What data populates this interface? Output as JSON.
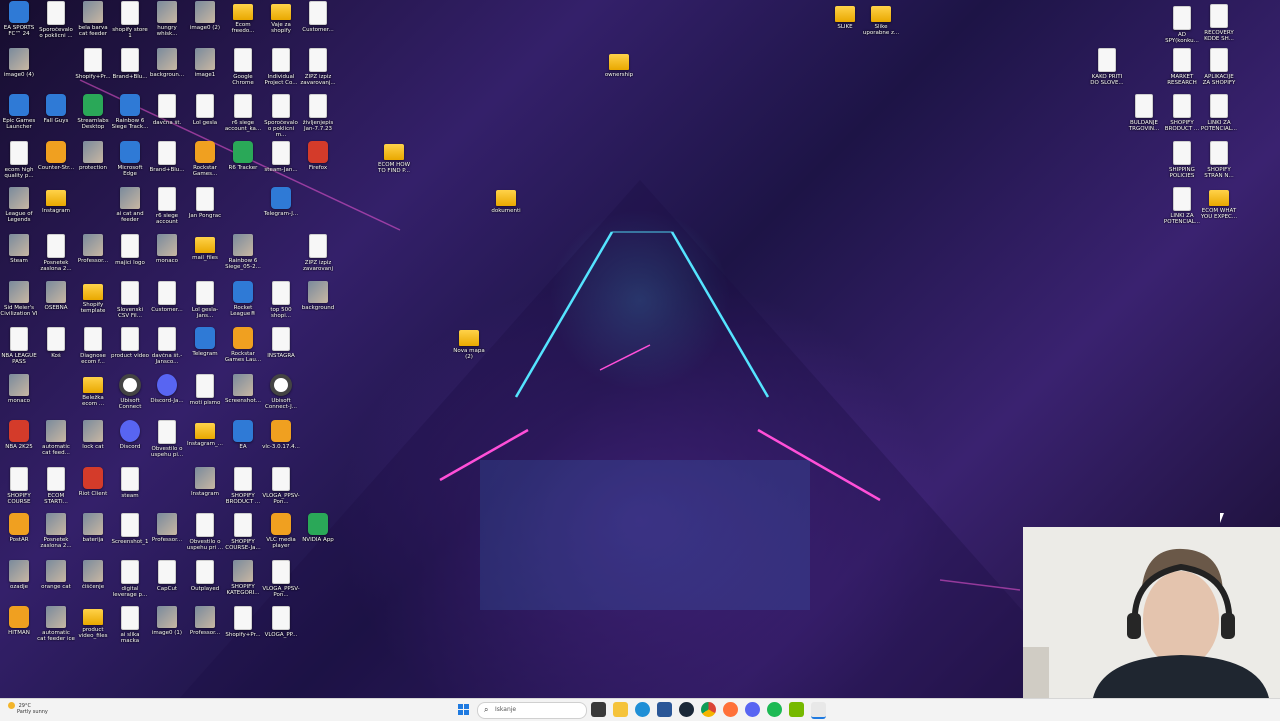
{
  "desktop": {
    "icons": [
      {
        "label": "EA SPORTS FC™ 24",
        "type": "app"
      },
      {
        "label": "Sporočevalo o poklicni ...",
        "type": "file"
      },
      {
        "label": "bela barva cat feeder",
        "type": "img"
      },
      {
        "label": "shopify store 1",
        "type": "file"
      },
      {
        "label": "hungry whisk...",
        "type": "img"
      },
      {
        "label": "image0 (2)",
        "type": "img"
      },
      {
        "label": "Ecom freedo...",
        "type": "folder"
      },
      {
        "label": "Vaje za shopify",
        "type": "folder"
      },
      {
        "label": "Customer...",
        "type": "file"
      },
      {
        "label": "SLIKE",
        "type": "folder"
      },
      {
        "label": "Slike uporabne z...",
        "type": "folder"
      },
      {
        "label": "AD SPY(konku...",
        "type": "file"
      },
      {
        "label": "RECOVERY KODE SH...",
        "type": "file"
      },
      {
        "label": "image0 (4)",
        "type": "img"
      },
      {
        "label": "Shopify+Pr...",
        "type": "file"
      },
      {
        "label": "Brand+Blu...",
        "type": "file"
      },
      {
        "label": "backgroun...",
        "type": "img"
      },
      {
        "label": "image1",
        "type": "img"
      },
      {
        "label": "Google Chrome",
        "type": "file"
      },
      {
        "label": "Individual Project Co...",
        "type": "file"
      },
      {
        "label": "ZIPZ izpiz zavarovanj...",
        "type": "file"
      },
      {
        "label": "ownership",
        "type": "folder"
      },
      {
        "label": "KAKO PRITI DO SLOVE...",
        "type": "file"
      },
      {
        "label": "MARKET RESEARCH",
        "type": "file"
      },
      {
        "label": "APLIKACIJE ZA SHOPIFY",
        "type": "file"
      },
      {
        "label": "Epic Games Launcher",
        "type": "app"
      },
      {
        "label": "Fall Guys",
        "type": "app"
      },
      {
        "label": "Streamlabs Desktop",
        "type": "app2"
      },
      {
        "label": "Rainbow 6 Siege Track...",
        "type": "app"
      },
      {
        "label": "davčna št.",
        "type": "file"
      },
      {
        "label": "Lol gesla",
        "type": "file"
      },
      {
        "label": "r6 siege account_ka...",
        "type": "file"
      },
      {
        "label": "Sporočevalo o poklicni m...",
        "type": "file"
      },
      {
        "label": "življenjepis Jan-7.7.23",
        "type": "file"
      },
      {
        "label": "BULDANJE TRGOVIN...",
        "type": "file"
      },
      {
        "label": "SHOPIFY BRODUCT ...",
        "type": "file"
      },
      {
        "label": "LINKI ZA POTENCIAL...",
        "type": "file"
      },
      {
        "label": "ecom high quality p...",
        "type": "file"
      },
      {
        "label": "Counter-Str...",
        "type": "app6"
      },
      {
        "label": "protection",
        "type": "img"
      },
      {
        "label": "Microsoft Edge",
        "type": "app"
      },
      {
        "label": "Brand+Blu...",
        "type": "file"
      },
      {
        "label": "Rockstar Games...",
        "type": "app6"
      },
      {
        "label": "R6 Tracker",
        "type": "app2"
      },
      {
        "label": "steam-Jan...",
        "type": "file"
      },
      {
        "label": "Firefox",
        "type": "app3"
      },
      {
        "label": "ECOM HOW TO FIND P...",
        "type": "folder"
      },
      {
        "label": "SHIPPING POLICIES",
        "type": "file"
      },
      {
        "label": "SHOPIFY STRAN N...",
        "type": "file"
      },
      {
        "label": "League of Legends",
        "type": "img"
      },
      {
        "label": "Instagram",
        "type": "folder"
      },
      {
        "label": "ai cat and feeder",
        "type": "img"
      },
      {
        "label": "r6 siege account",
        "type": "file"
      },
      {
        "label": "Jan Pongrac",
        "type": "file"
      },
      {
        "label": "Telegram-J...",
        "type": "app"
      },
      {
        "label": "dokumenti",
        "type": "folder"
      },
      {
        "label": "LINKI ZA POTENCIAL...",
        "type": "file"
      },
      {
        "label": "ECOM WHAT YOU EXPEC...",
        "type": "folder"
      },
      {
        "label": "Steam",
        "type": "img"
      },
      {
        "label": "Posnetek zaslona 2...",
        "type": "file"
      },
      {
        "label": "Professor...",
        "type": "img"
      },
      {
        "label": "majici logo",
        "type": "file"
      },
      {
        "label": "monaco",
        "type": "img"
      },
      {
        "label": "mail_files",
        "type": "folder"
      },
      {
        "label": "Rainbow 6 Siege_05-2...",
        "type": "img"
      },
      {
        "label": "ZIPZ izpiz zavarovanj",
        "type": "file"
      },
      {
        "label": "Sid Meier's Civilization VI",
        "type": "img"
      },
      {
        "label": "OSEBNA",
        "type": "img"
      },
      {
        "label": "Shopify template",
        "type": "folder"
      },
      {
        "label": "Slovenski CSV Fil...",
        "type": "file"
      },
      {
        "label": "Customer...",
        "type": "file"
      },
      {
        "label": "Lol gesla-Jans...",
        "type": "file"
      },
      {
        "label": "Rocket League®",
        "type": "app"
      },
      {
        "label": "top 500 shopi...",
        "type": "file"
      },
      {
        "label": "background",
        "type": "img"
      },
      {
        "label": "NBA LEAGUE PASS",
        "type": "file"
      },
      {
        "label": "Koš",
        "type": "file"
      },
      {
        "label": "Diagnose ecom f...",
        "type": "file"
      },
      {
        "label": "product video",
        "type": "file"
      },
      {
        "label": "davčna št.-Jansco...",
        "type": "file"
      },
      {
        "label": "Telegram",
        "type": "app"
      },
      {
        "label": "Rockstar Games Lau...",
        "type": "app6"
      },
      {
        "label": "INSTAGRA",
        "type": "file"
      },
      {
        "label": "Nova mapa (2)",
        "type": "folder"
      },
      {
        "label": "monaco",
        "type": "img"
      },
      {
        "label": "Beležka ecom ...",
        "type": "folder"
      },
      {
        "label": "Ubisoft Connect",
        "type": "app5"
      },
      {
        "label": "Discord-Ja...",
        "type": "app4"
      },
      {
        "label": "moti pismo",
        "type": "file"
      },
      {
        "label": "Screenshot...",
        "type": "img"
      },
      {
        "label": "Ubisoft Connect-J...",
        "type": "app5"
      },
      {
        "label": "NBA 2K25",
        "type": "app3"
      },
      {
        "label": "automatic cat feed...",
        "type": "img"
      },
      {
        "label": "lock cat",
        "type": "img"
      },
      {
        "label": "Discord",
        "type": "app4"
      },
      {
        "label": "Obvestilo o uspehu pi...",
        "type": "file"
      },
      {
        "label": "Instagram_...",
        "type": "folder"
      },
      {
        "label": "EA",
        "type": "app"
      },
      {
        "label": "vlc-3.0.17.4...",
        "type": "app6"
      },
      {
        "label": "SHOPIFY COURSE",
        "type": "file"
      },
      {
        "label": "ECOM STARTI...",
        "type": "file"
      },
      {
        "label": "Riot Client",
        "type": "app3"
      },
      {
        "label": "steam",
        "type": "file"
      },
      {
        "label": "Instagram",
        "type": "img"
      },
      {
        "label": "SHOPIFY BRODUCT ...",
        "type": "file"
      },
      {
        "label": "VLOGA_PPSV-Pon...",
        "type": "file"
      },
      {
        "label": "PostAR",
        "type": "app6"
      },
      {
        "label": "Posnetek zaslona 2...",
        "type": "img"
      },
      {
        "label": "baterija",
        "type": "img"
      },
      {
        "label": "Screenshot_1",
        "type": "file"
      },
      {
        "label": "Professor...",
        "type": "img"
      },
      {
        "label": "Obvestilo o uspehu pri ...",
        "type": "file"
      },
      {
        "label": "SHOPIFY COURSE-Ja...",
        "type": "file"
      },
      {
        "label": "VLC media player",
        "type": "app6"
      },
      {
        "label": "NVIDIA App",
        "type": "app2"
      },
      {
        "label": "ozadje",
        "type": "img"
      },
      {
        "label": "orange cat",
        "type": "img"
      },
      {
        "label": "čiščenje",
        "type": "img"
      },
      {
        "label": "digital leverage p...",
        "type": "file"
      },
      {
        "label": "CapCut",
        "type": "file"
      },
      {
        "label": "Outplayed",
        "type": "file"
      },
      {
        "label": "SHOPIFY KATEGORI...",
        "type": "img"
      },
      {
        "label": "VLOGA_PPSV-Pon...",
        "type": "file"
      },
      {
        "label": "HITMAN",
        "type": "app6"
      },
      {
        "label": "automatic cat feeder ice",
        "type": "img"
      },
      {
        "label": "product video_files",
        "type": "folder"
      },
      {
        "label": "ai slika macka",
        "type": "file"
      },
      {
        "label": "image0 (1)",
        "type": "img"
      },
      {
        "label": "Professor...",
        "type": "img"
      },
      {
        "label": "Shopify+Pr...",
        "type": "file"
      },
      {
        "label": "VLOGA_PP...",
        "type": "file"
      }
    ]
  },
  "taskbar": {
    "weather_temp": "29°C",
    "weather_desc": "Partly sunny",
    "search_placeholder": "Iskanje",
    "apps": [
      "file-explorer",
      "folder",
      "edge",
      "browser",
      "steam",
      "chrome",
      "firefox",
      "discord",
      "spotify",
      "nvidia",
      "code"
    ]
  }
}
